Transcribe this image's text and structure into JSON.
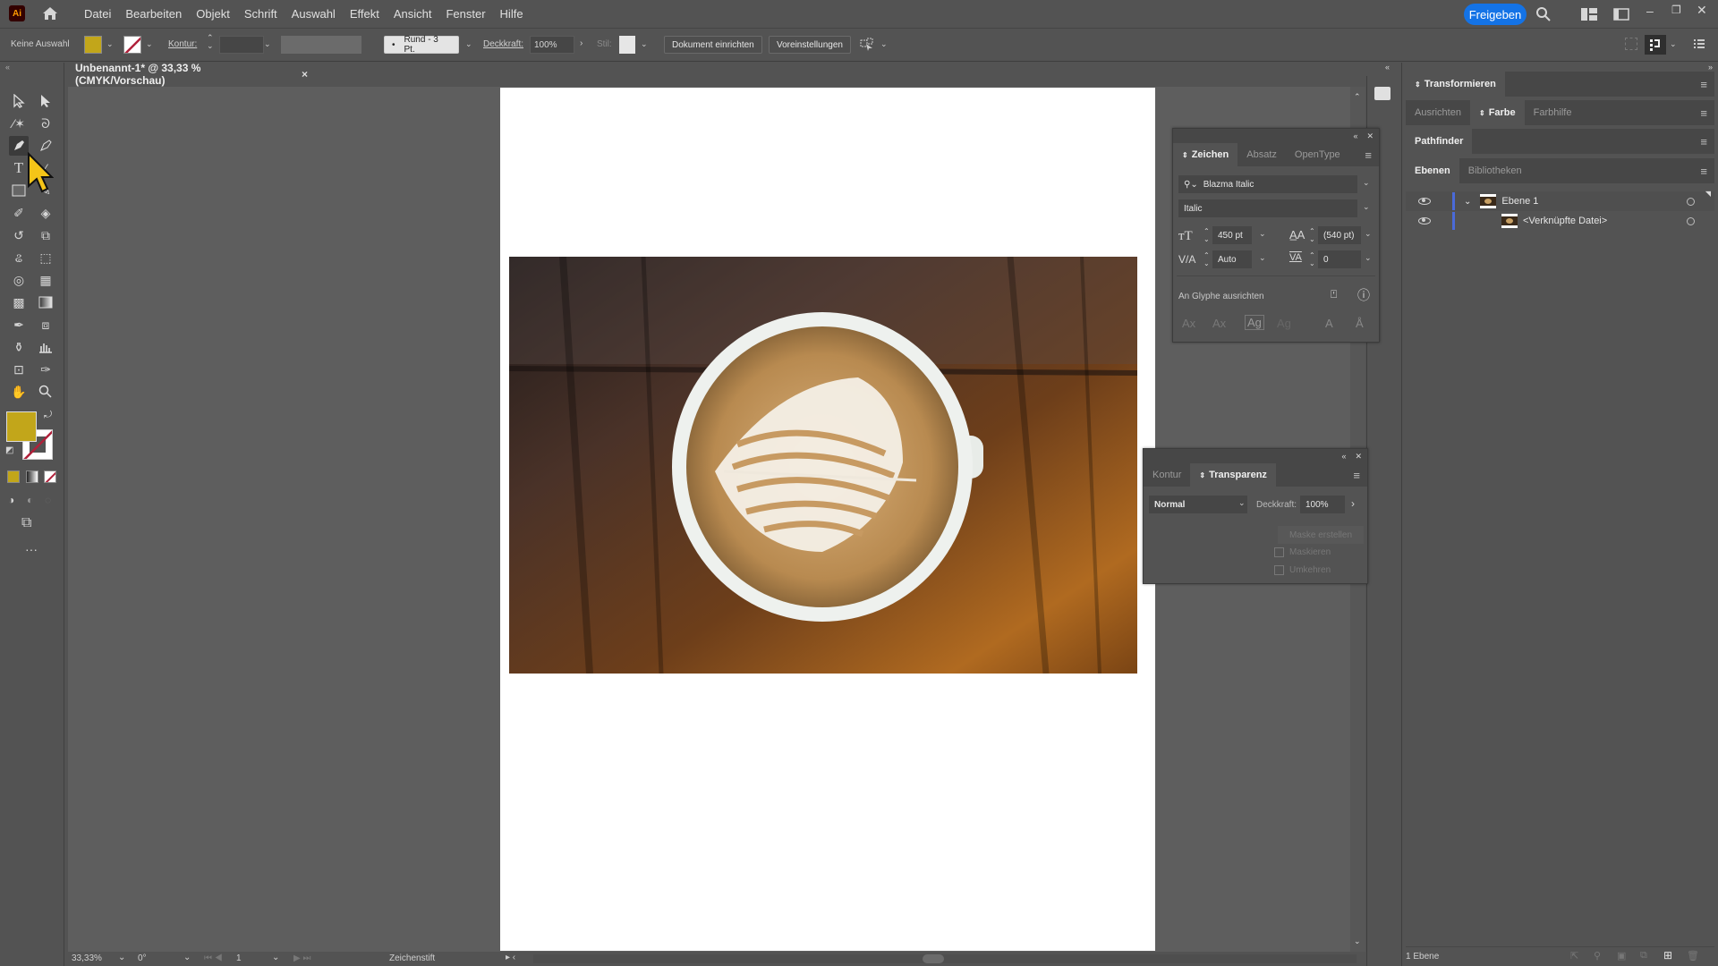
{
  "app": {
    "logo": "Ai",
    "share_button": "Freigeben"
  },
  "menu": [
    "Datei",
    "Bearbeiten",
    "Objekt",
    "Schrift",
    "Auswahl",
    "Effekt",
    "Ansicht",
    "Fenster",
    "Hilfe"
  ],
  "control_bar": {
    "selection": "Keine Auswahl",
    "fill_color": "#c2a61a",
    "stroke_label": "Kontur:",
    "stroke_weight": "",
    "brush": "Rund - 3 Pt.",
    "opacity_label": "Deckkraft:",
    "opacity_value": "100%",
    "style_label": "Stil:",
    "document_setup": "Dokument einrichten",
    "preferences": "Voreinstellungen"
  },
  "document_tab": {
    "title": "Unbenannt-1* @ 33,33 % (CMYK/Vorschau)",
    "close": "×"
  },
  "tools": {
    "fill_color": "#c2a61a",
    "stroke_color": "none",
    "active_tool": "Zeichenstift-Werkzeug"
  },
  "status_bar": {
    "zoom": "33,33%",
    "rotation": "0°",
    "artboard_number": "1",
    "current_tool": "Zeichenstift"
  },
  "character_panel": {
    "tabs": [
      "Zeichen",
      "Absatz",
      "OpenType"
    ],
    "active_tab": "Zeichen",
    "font_family": "Blazma Italic",
    "font_style": "Italic",
    "font_size": "450 pt",
    "leading": "(540 pt)",
    "kerning": "Auto",
    "tracking": "0",
    "snap_label": "An Glyphe ausrichten"
  },
  "transparency_panel": {
    "tabs": [
      "Kontur",
      "Transparenz"
    ],
    "active_tab": "Transparenz",
    "blend_mode": "Normal",
    "opacity_label": "Deckkraft:",
    "opacity_value": "100%",
    "make_mask": "Maske erstellen",
    "clip": "Maskieren",
    "invert": "Umkehren"
  },
  "right_dock": {
    "transform": "Transformieren",
    "color_tabs": [
      "Ausrichten",
      "Farbe",
      "Farbhilfe"
    ],
    "color_active": "Farbe",
    "pathfinder": "Pathfinder",
    "layer_tabs": [
      "Ebenen",
      "Bibliotheken"
    ],
    "layers_active": "Ebenen",
    "layers": [
      {
        "name": "Ebene 1",
        "visible": true,
        "expanded": true
      },
      {
        "name": "<Verknüpfte Datei>",
        "visible": true
      }
    ],
    "layer_count": "1 Ebene"
  }
}
